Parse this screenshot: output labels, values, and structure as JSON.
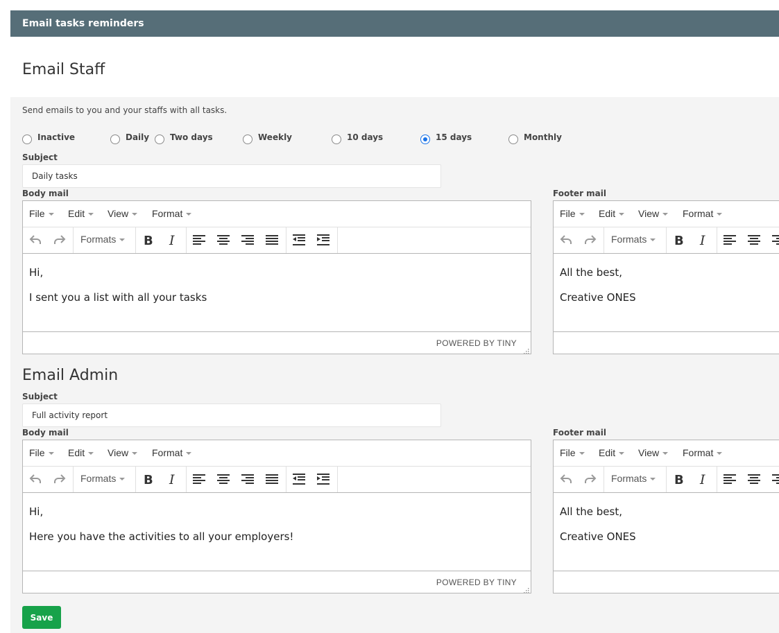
{
  "header": {
    "title": "Email tasks reminders"
  },
  "staff": {
    "title": "Email Staff",
    "description": "Send emails to you and your staffs with all tasks.",
    "frequency_options": [
      "Inactive",
      "Daily",
      "Two days",
      "Weekly",
      "10 days",
      "15 days",
      "Monthly"
    ],
    "selected_frequency": "15 days",
    "subject_label": "Subject",
    "subject_value": "Daily tasks",
    "body_label": "Body mail",
    "footer_label": "Footer mail",
    "body_lines": [
      "Hi,",
      "I sent you a list with all your tasks"
    ],
    "footer_lines": [
      "All the best,",
      "Creative ONES"
    ]
  },
  "admin": {
    "title": "Email Admin",
    "subject_label": "Subject",
    "subject_value": "Full activity report",
    "body_label": "Body mail",
    "footer_label": "Footer mail",
    "body_lines": [
      "Hi,",
      "Here you have the activities to all your employers!"
    ],
    "footer_lines": [
      "All the best,",
      "Creative ONES"
    ]
  },
  "editor": {
    "menu": [
      "File",
      "Edit",
      "View",
      "Format"
    ],
    "formats_label": "Formats",
    "powered_by": "POWERED BY TINY",
    "toolbar_icons": [
      "undo-icon",
      "redo-icon",
      "bold-icon",
      "italic-icon",
      "align-left-icon",
      "align-center-icon",
      "align-right-icon",
      "align-justify-icon",
      "outdent-icon",
      "indent-icon"
    ]
  },
  "actions": {
    "save_label": "Save"
  },
  "colors": {
    "header": "#566e78",
    "save": "#17a24a",
    "radio_selected": "#1a73e8"
  }
}
